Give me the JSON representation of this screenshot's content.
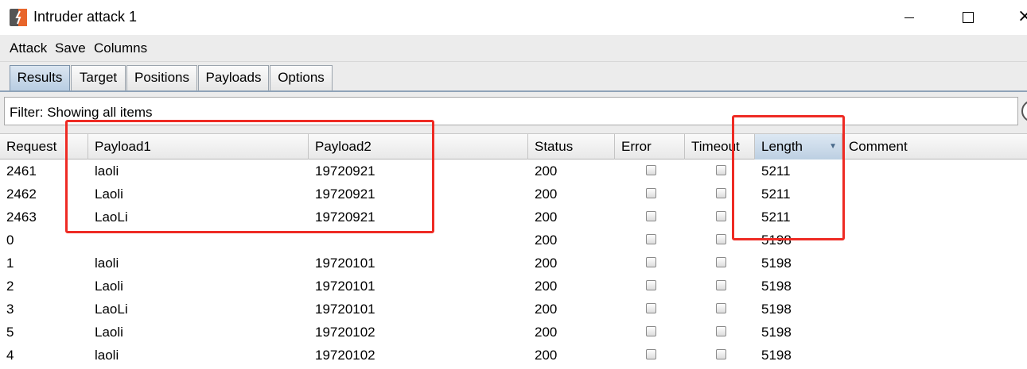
{
  "window": {
    "title": "Intruder attack 1",
    "minimize_glyph": "",
    "close_glyph": "×",
    "icon": "burp-suite-icon"
  },
  "menu": [
    "Attack",
    "Save",
    "Columns"
  ],
  "tabs": [
    {
      "label": "Results",
      "active": true
    },
    {
      "label": "Target",
      "active": false
    },
    {
      "label": "Positions",
      "active": false
    },
    {
      "label": "Payloads",
      "active": false
    },
    {
      "label": "Options",
      "active": false
    }
  ],
  "filter": {
    "text": "Filter: Showing all items"
  },
  "table": {
    "columns": [
      "Request",
      "Payload1",
      "Payload2",
      "Status",
      "Error",
      "Timeout",
      "Length",
      "Comment"
    ],
    "sorted_column": "Length",
    "sort_direction": "descending",
    "rows": [
      {
        "request": "2461",
        "payload1": "laoli",
        "payload2": "19720921",
        "status": "200",
        "error": false,
        "timeout": false,
        "length": "5211",
        "comment": ""
      },
      {
        "request": "2462",
        "payload1": "Laoli",
        "payload2": "19720921",
        "status": "200",
        "error": false,
        "timeout": false,
        "length": "5211",
        "comment": ""
      },
      {
        "request": "2463",
        "payload1": "LaoLi",
        "payload2": "19720921",
        "status": "200",
        "error": false,
        "timeout": false,
        "length": "5211",
        "comment": ""
      },
      {
        "request": "0",
        "payload1": "",
        "payload2": "",
        "status": "200",
        "error": false,
        "timeout": false,
        "length": "5198",
        "comment": ""
      },
      {
        "request": "1",
        "payload1": "laoli",
        "payload2": "19720101",
        "status": "200",
        "error": false,
        "timeout": false,
        "length": "5198",
        "comment": ""
      },
      {
        "request": "2",
        "payload1": "Laoli",
        "payload2": "19720101",
        "status": "200",
        "error": false,
        "timeout": false,
        "length": "5198",
        "comment": ""
      },
      {
        "request": "3",
        "payload1": "LaoLi",
        "payload2": "19720101",
        "status": "200",
        "error": false,
        "timeout": false,
        "length": "5198",
        "comment": ""
      },
      {
        "request": "5",
        "payload1": "Laoli",
        "payload2": "19720102",
        "status": "200",
        "error": false,
        "timeout": false,
        "length": "5198",
        "comment": ""
      },
      {
        "request": "4",
        "payload1": "laoli",
        "payload2": "19720102",
        "status": "200",
        "error": false,
        "timeout": false,
        "length": "5198",
        "comment": ""
      }
    ]
  },
  "colors": {
    "annotation": "#ee2b24",
    "active_tab": "#b8cde2",
    "app_icon": "#e8652b"
  }
}
